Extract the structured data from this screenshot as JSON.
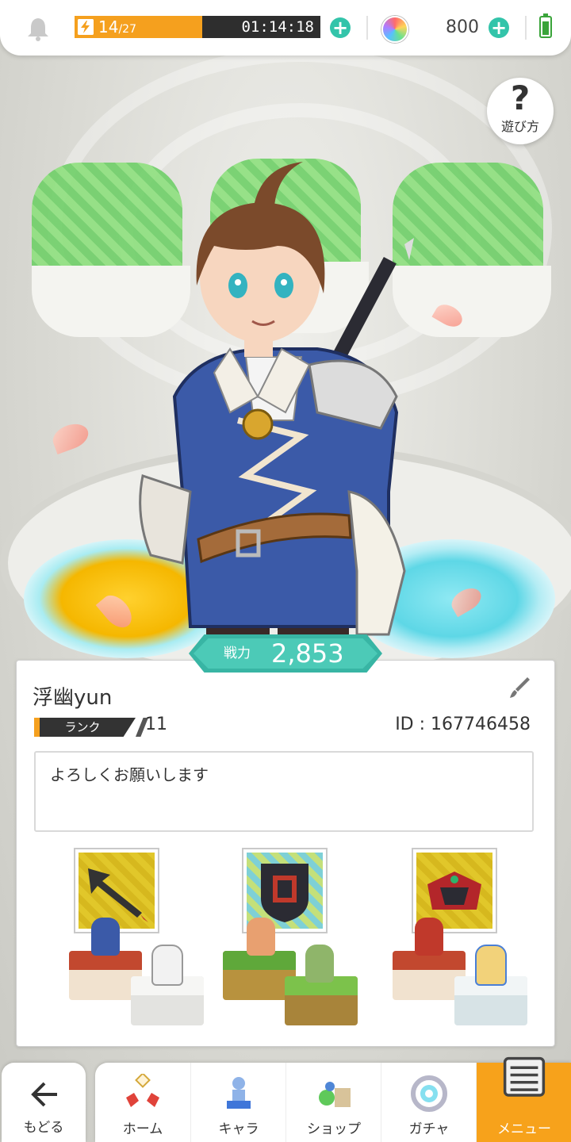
{
  "status_bar": {
    "stamina_current": "14",
    "stamina_max": "/27",
    "stamina_fraction": 0.519,
    "timer": "01:14:18",
    "gems": "800",
    "accent_color": "#33c4aa",
    "stamina_color": "#f5a01e"
  },
  "help": {
    "label": "遊び方"
  },
  "power": {
    "label": "戦力",
    "value": "2,853"
  },
  "profile": {
    "name": "浮幽yun",
    "rank_label": "ランク",
    "rank_value": "11",
    "id_text": "ID : 167746458",
    "message": "よろしくお願いします"
  },
  "team": [
    {
      "equipment_icon": "arrow-weapon-icon",
      "front_block": "red",
      "back_block": "white"
    },
    {
      "equipment_icon": "shield-icon",
      "front_block": "green",
      "back_block": "green"
    },
    {
      "equipment_icon": "armor-icon",
      "front_block": "red",
      "back_block": "white"
    }
  ],
  "nav": {
    "back_label": "もどる",
    "items": [
      {
        "label": "ホーム",
        "icon": "home-icon"
      },
      {
        "label": "キャラ",
        "icon": "character-icon"
      },
      {
        "label": "ショップ",
        "icon": "shop-icon"
      },
      {
        "label": "ガチャ",
        "icon": "gacha-icon"
      },
      {
        "label": "メニュー",
        "icon": "menu-icon",
        "active": true
      }
    ],
    "active_color": "#f7a21b"
  }
}
